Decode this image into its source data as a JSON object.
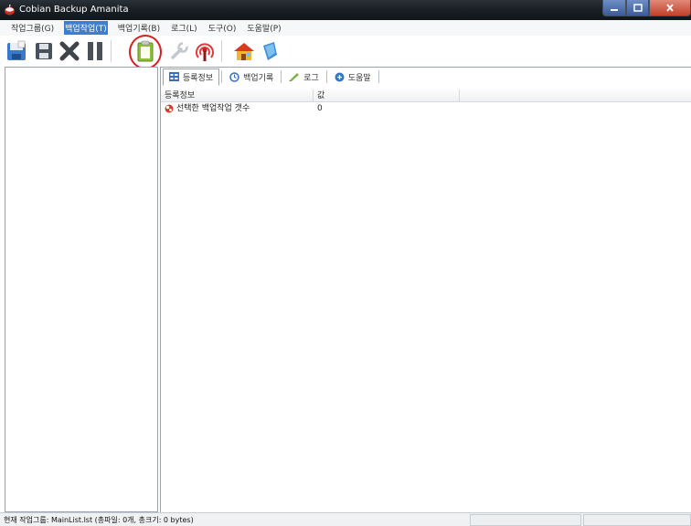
{
  "window": {
    "title": "Cobian Backup Amanita",
    "logo_icon": "cobian-logo-icon"
  },
  "menu": [
    {
      "label": "작업그룹(G)",
      "active": false
    },
    {
      "label": "백업작업(T)",
      "active": true
    },
    {
      "label": "백업기록(B)",
      "active": false
    },
    {
      "label": "로그(L)",
      "active": false
    },
    {
      "label": "도구(O)",
      "active": false
    },
    {
      "label": "도움말(P)",
      "active": false
    }
  ],
  "toolbar": {
    "buttons": [
      "new-task-icon",
      "save-icon",
      "delete-icon",
      "pause-icon",
      "clipboard-icon",
      "wrench-icon",
      "signal-icon",
      "home-icon",
      "shield-icon"
    ],
    "highlight_color": "#d71d1d"
  },
  "tabs": [
    {
      "label": "등록정보",
      "icon": "properties-icon",
      "active": true
    },
    {
      "label": "백업기록",
      "icon": "history-icon",
      "active": false
    },
    {
      "label": "로그",
      "icon": "log-icon",
      "active": false
    },
    {
      "label": "도움말",
      "icon": "help-icon",
      "active": false
    }
  ],
  "grid": {
    "columns": [
      "등록정보",
      "값"
    ],
    "rows": [
      {
        "name": "선택한 백업작업 갯수",
        "value": "0",
        "icon": "task-count-icon"
      }
    ]
  },
  "status": {
    "text": "현재 작업그룹: MainList.lst (총파일: 0개, 총크기: 0 bytes)"
  }
}
